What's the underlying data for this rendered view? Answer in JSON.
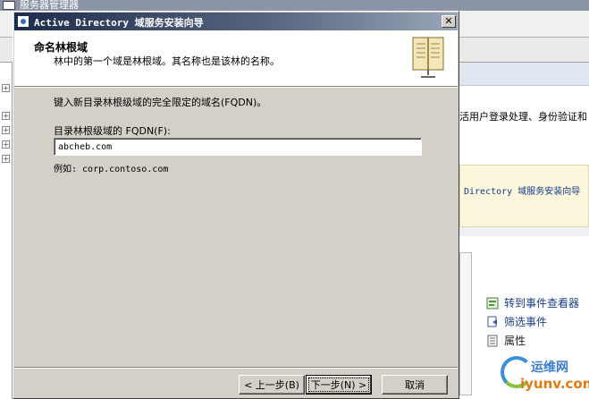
{
  "background_window": {
    "title": "服务器管理器",
    "description_text": "活用户登录处理、身份验证和",
    "wizard_link_text": "Directory 域服务安装向导",
    "actions": [
      {
        "label": "转到事件查看器",
        "icon": "event-viewer-icon"
      },
      {
        "label": "筛选事件",
        "icon": "filter-icon"
      },
      {
        "label": "属性",
        "icon": "properties-icon"
      }
    ]
  },
  "watermark": {
    "cn": "运维网",
    "en": "iyunv.com"
  },
  "dialog": {
    "title": "Active Directory 域服务安装向导",
    "close_label": "✕",
    "header": {
      "title": "命名林根域",
      "subtitle": "林中的第一个域是林根域。其名称也是该林的名称。",
      "icon": "book-icon"
    },
    "body": {
      "instruction": "键入新目录林根级域的完全限定的域名(FQDN)。",
      "field_label": "目录林根级域的 FQDN(F):",
      "fqdn_value": "abcheb.com",
      "example": "例如: corp.contoso.com"
    },
    "buttons": {
      "back": "< 上一步(B)",
      "next": "下一步(N) >",
      "cancel": "取消"
    }
  }
}
